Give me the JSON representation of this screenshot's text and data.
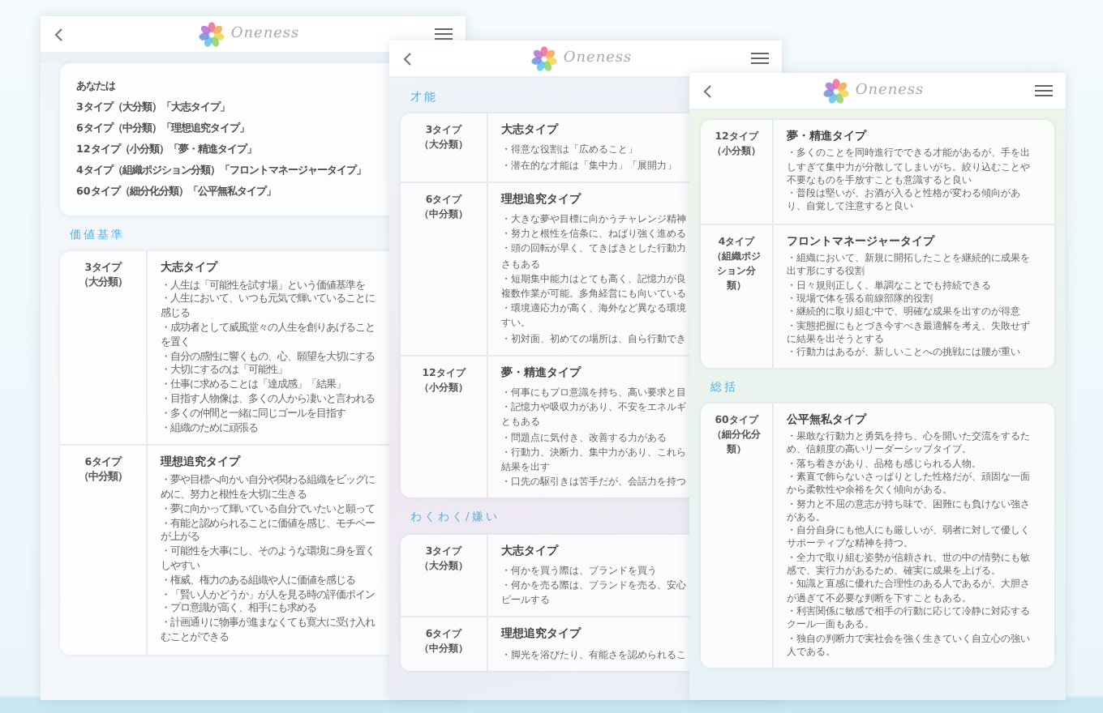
{
  "windows": [
    {
      "brand": "Oneness",
      "blocks": [
        {
          "kind": "summary",
          "lines": [
            "あなたは",
            "3タイプ（大分類）「大志タイプ」",
            "6タイプ（中分類）「理想追究タイプ」",
            "12タイプ（小分類）「夢・精進タイプ」",
            "4タイプ（組織ポジション分類）「フロントマネージャータイプ」",
            "60タイプ（細分化分類）「公平無私タイプ」"
          ]
        },
        {
          "kind": "heading",
          "text": "価値基準"
        },
        {
          "kind": "table",
          "rows": [
            {
              "label": [
                "3タイプ",
                "（大分類）"
              ],
              "title": "大志タイプ",
              "lines": [
                "・人生は「可能性を試す場」という価値基準を",
                "・人生において、いつも元気で輝いていることに",
                "感じる",
                "・成功者として威風堂々の人生を創りあげること",
                "を置く",
                "・自分の感性に響くもの、心、願望を大切にする",
                "・大切にするのは「可能性」",
                "・仕事に求めることは「達成感」「結果」",
                "・目指す人物像は、多くの人から凄いと言われる",
                "・多くの仲間と一緒に同じゴールを目指す",
                "・組織のために頑張る"
              ]
            },
            {
              "label": [
                "6タイプ",
                "（中分類）"
              ],
              "title": "理想追究タイプ",
              "lines": [
                "・夢や目標へ向かい自分や関わる組織をビッグに",
                "めに、努力と根性を大切に生きる",
                "・夢に向かって輝いている自分でいたいと願って",
                "・有能と認められることに価値を感じ、モチベー",
                "が上がる",
                "・可能性を大事にし、そのような環境に身を置く",
                "しやすい",
                "・権威、権力のある組織や人に価値を感じる",
                "・「賢い人かどうか」が人を見る時の評価ポイン",
                "・プロ意識が高く、相手にも求める",
                "・計画通りに物事が進まなくても寛大に受け入れ",
                "むことができる"
              ]
            }
          ]
        }
      ]
    },
    {
      "brand": "Oneness",
      "blocks": [
        {
          "kind": "heading",
          "text": "才能"
        },
        {
          "kind": "table",
          "rows": [
            {
              "label": [
                "3タイプ",
                "（大分類）"
              ],
              "title": "大志タイプ",
              "lines": [
                "・得意な役割は「広めること」",
                "・潜在的な才能は「集中力」「展開力」"
              ]
            },
            {
              "label": [
                "6タイプ",
                "（中分類）"
              ],
              "title": "理想追究タイプ",
              "lines": [
                "・大きな夢や目標に向かうチャレンジ精神",
                "・努力と根性を信条に、ねばり強く進める",
                "・頭の回転が早く、てきぱきとした行動力",
                "さもある",
                "・短期集中能力はとても高く、記憶力が良",
                "複数作業が可能。多角経営にも向いている",
                "・環境適応力が高く、海外など異なる環境",
                "すい。",
                "・初対面、初めての場所は、自ら行動でき"
              ]
            },
            {
              "label": [
                "12タイプ",
                "（小分類）"
              ],
              "title": "夢・精進タイプ",
              "lines": [
                "・何事にもプロ意識を持ち、高い要求と目",
                "・記憶力や吸収力があり、不安をエネルギ",
                "ともある",
                "・問題点に気付き、改善する力がある",
                "・行動力、決断力、集中力があり、これら",
                "結果を出す",
                "・口先の駆引きは苦手だが、会話力を持つ"
              ]
            }
          ]
        },
        {
          "kind": "heading",
          "text": "わくわく/嫌い"
        },
        {
          "kind": "table",
          "rows": [
            {
              "label": [
                "3タイプ",
                "（大分類）"
              ],
              "title": "大志タイプ",
              "lines": [
                "・何かを買う際は、ブランドを買う",
                "・何かを売る際は、ブランドを売る、安心",
                "ピールする"
              ]
            },
            {
              "label": [
                "6タイプ",
                "（中分類）"
              ],
              "title": "理想追究タイプ",
              "lines": [
                "・脚光を浴びたり、有能さを認められるこ"
              ]
            }
          ]
        }
      ]
    },
    {
      "brand": "Oneness",
      "blocks": [
        {
          "kind": "table",
          "rows": [
            {
              "label": [
                "12タイプ",
                "（小分類）"
              ],
              "title": "夢・精進タイプ",
              "lines": [
                "・多くのことを同時進行でできる才能があるが、手を出",
                "しすぎて集中力が分散してしまいがち。絞り込むことや",
                "不要なものを手放すことも意識すると良い",
                "・普段は堅いが、お酒が入ると性格が変わる傾向があ",
                "り、自覚して注意すると良い"
              ]
            },
            {
              "label": [
                "4タイプ",
                "（組織ポジ",
                "ション分",
                "類）"
              ],
              "title": "フロントマネージャータイプ",
              "lines": [
                "・組織において、新規に開拓したことを継続的に成果を",
                "出す形にする役割",
                "・日々規則正しく、単調なことでも持続できる",
                "・現場で体を張る前線部隊的役割",
                "・継続的に取り組む中で、明確な成果を出すのが得意",
                "・実態把握にもとづき今すべき最適解を考え、失敗せず",
                "に結果を出そうとする",
                "・行動力はあるが、新しいことへの挑戦には腰が重い"
              ]
            }
          ]
        },
        {
          "kind": "heading",
          "text": "総括"
        },
        {
          "kind": "table",
          "rows": [
            {
              "label": [
                "60タイプ",
                "（細分化分",
                "類）"
              ],
              "title": "公平無私タイプ",
              "lines": [
                "・果敢な行動力と勇気を持ち、心を開いた交流をするた",
                "め、信頼度の高いリーダーシップタイプ。",
                "・落ち着きがあり、品格も感じられる人物。",
                "・素直で飾らないさっぱりとした性格だが、頑固な一面",
                "から柔軟性や余裕を欠く傾向がある。",
                "・努力と不屈の意志が持ち味で、困難にも負けない強さ",
                "がある。",
                "・自分自身にも他人にも厳しいが、弱者に対して優しく",
                "サポーティブな精神を持つ。",
                "・全力で取り組む姿勢が信頼され、世の中の情勢にも敏",
                "感で、実行力があるため、確実に成果を上げる。",
                "・知識と直感に優れた合理性のある人であるが、大胆さ",
                "が過ぎて不必要な判断を下すこともある。",
                "・利害関係に敏感で相手の行動に応じて冷静に対応する",
                "クール一面もある。",
                "・独自の判断力で実社会を強く生きていく自立心の強い",
                "人である。"
              ]
            }
          ]
        }
      ]
    }
  ]
}
